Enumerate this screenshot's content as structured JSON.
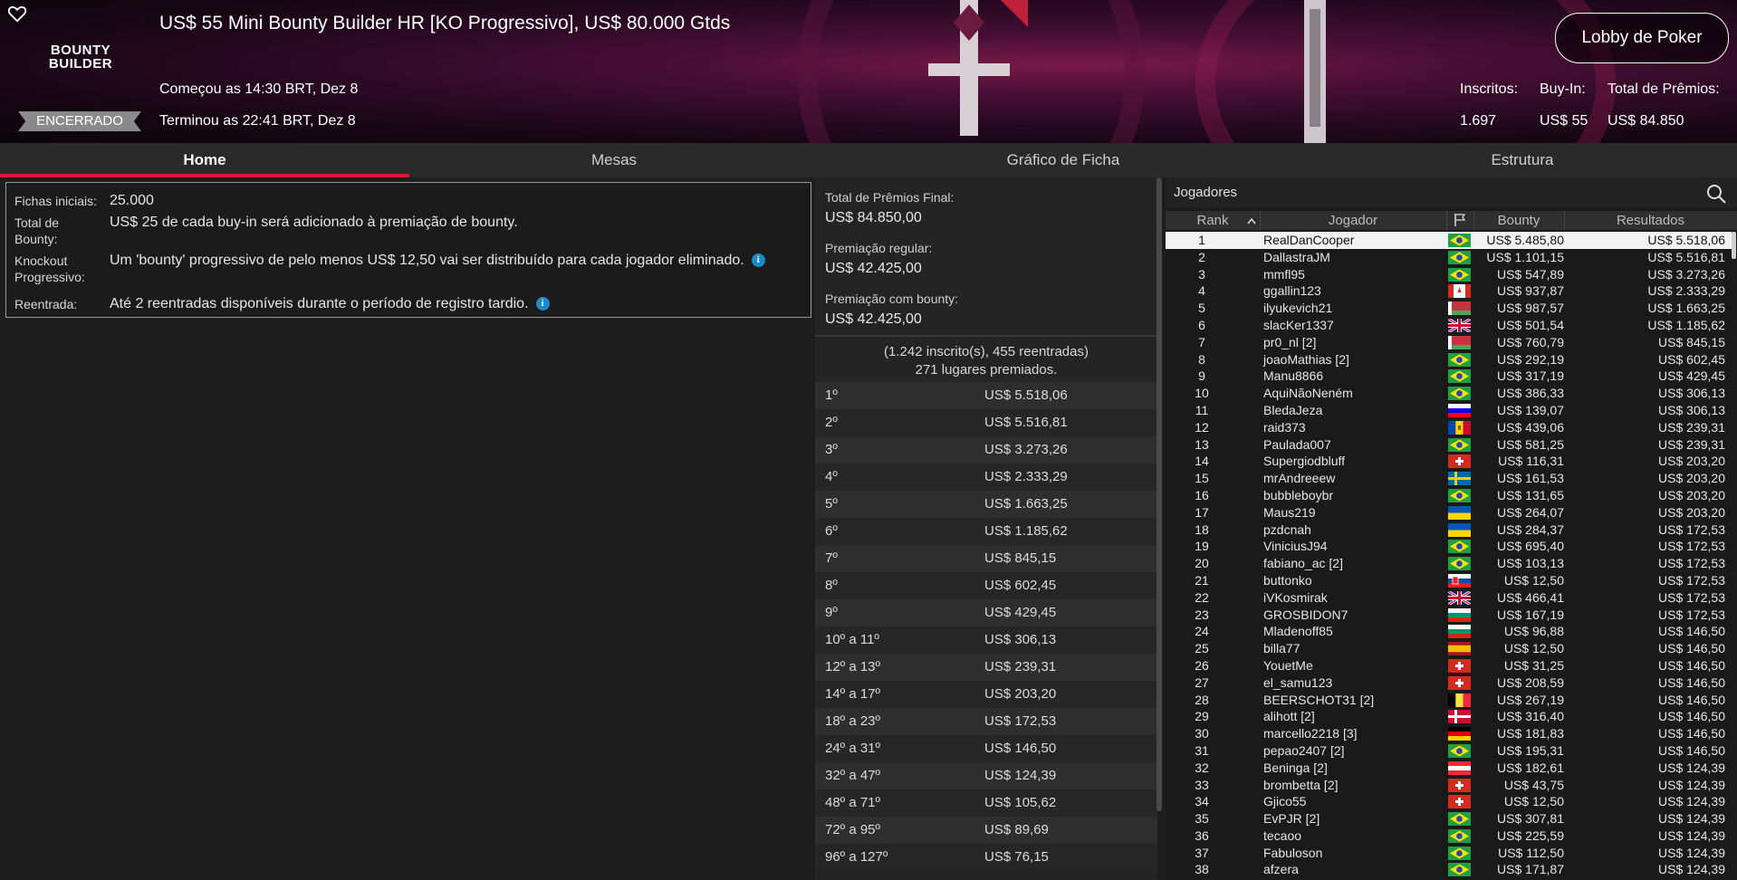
{
  "header": {
    "title": "US$ 55 Mini Bounty Builder HR [KO Progressivo], US$ 80.000 Gtds",
    "logo_line1": "BOUNTY",
    "logo_line2": "BUILDER",
    "status": "ENCERRADO",
    "started": "Começou as 14:30 BRT, Dez 8",
    "ended": "Terminou as 22:41 BRT, Dez 8",
    "lobby_button": "Lobby de Poker",
    "stats": {
      "entrants_label": "Inscritos:",
      "entrants_value": "1.697",
      "buyin_label": "Buy-In:",
      "buyin_value": "US$ 55",
      "prize_label": "Total de Prêmios:",
      "prize_value": "US$ 84.850"
    },
    "favorite_icon": "heart-outline-icon"
  },
  "tabs": [
    "Home",
    "Mesas",
    "Gráfico de Ficha",
    "Estrutura"
  ],
  "info": {
    "rows": [
      {
        "label": "Fichas iniciais:",
        "value": "25.000"
      },
      {
        "label": "Total de Bounty:",
        "value": "US$ 25 de cada buy-in será adicionado à premiação de bounty."
      },
      {
        "label": "Knockout Progressivo:",
        "value": "Um 'bounty' progressivo de pelo menos US$ 12,50 vai ser distribuído para cada jogador eliminado."
      },
      {
        "label": "Reentrada:",
        "value": "Até 2 reentradas disponíveis durante o período de registro tardio."
      }
    ],
    "info_icon": "i"
  },
  "prizes": {
    "total_label": "Total de Prêmios Final:",
    "total_value": "US$ 84.850,00",
    "regular_label": "Premiação regular:",
    "regular_value": "US$ 42.425,00",
    "bounty_label": "Premiação com bounty:",
    "bounty_value": "US$ 42.425,00",
    "summary_line1": "(1.242 inscrito(s), 455 reentradas)",
    "summary_line2": "271 lugares premiados.",
    "rows": [
      {
        "pos": "1º",
        "amount": "US$ 5.518,06"
      },
      {
        "pos": "2º",
        "amount": "US$ 5.516,81"
      },
      {
        "pos": "3º",
        "amount": "US$ 3.273,26"
      },
      {
        "pos": "4º",
        "amount": "US$ 2.333,29"
      },
      {
        "pos": "5º",
        "amount": "US$ 1.663,25"
      },
      {
        "pos": "6º",
        "amount": "US$ 1.185,62"
      },
      {
        "pos": "7º",
        "amount": "US$ 845,15"
      },
      {
        "pos": "8º",
        "amount": "US$ 602,45"
      },
      {
        "pos": "9º",
        "amount": "US$ 429,45"
      },
      {
        "pos": "10º a 11º",
        "amount": "US$ 306,13"
      },
      {
        "pos": "12º a 13º",
        "amount": "US$ 239,31"
      },
      {
        "pos": "14º a 17º",
        "amount": "US$ 203,20"
      },
      {
        "pos": "18º a 23º",
        "amount": "US$ 172,53"
      },
      {
        "pos": "24º a 31º",
        "amount": "US$ 146,50"
      },
      {
        "pos": "32º a 47º",
        "amount": "US$ 124,39"
      },
      {
        "pos": "48º a 71º",
        "amount": "US$ 105,62"
      },
      {
        "pos": "72º a 95º",
        "amount": "US$ 89,69"
      },
      {
        "pos": "96º a 127º",
        "amount": "US$ 76,15"
      }
    ]
  },
  "players": {
    "title": "Jogadores",
    "search_icon": "search-icon",
    "columns": {
      "rank": "Rank",
      "player": "Jogador",
      "country": "flag-icon",
      "bounty": "Bounty",
      "results": "Resultados"
    },
    "rows": [
      {
        "rank": "1",
        "name": "RealDanCooper",
        "flag": "BR",
        "bounty": "US$ 5.485,80",
        "result": "US$ 5.518,06"
      },
      {
        "rank": "2",
        "name": "DallastraJM",
        "flag": "BR",
        "bounty": "US$ 1.101,15",
        "result": "US$ 5.516,81"
      },
      {
        "rank": "3",
        "name": "mmfl95",
        "flag": "BR",
        "bounty": "US$ 547,89",
        "result": "US$ 3.273,26"
      },
      {
        "rank": "4",
        "name": "ggallin123",
        "flag": "CA",
        "bounty": "US$ 937,87",
        "result": "US$ 2.333,29"
      },
      {
        "rank": "5",
        "name": "ilyukevich21",
        "flag": "BY",
        "bounty": "US$ 987,57",
        "result": "US$ 1.663,25"
      },
      {
        "rank": "6",
        "name": "slacKer1337",
        "flag": "GB",
        "bounty": "US$ 501,54",
        "result": "US$ 1.185,62"
      },
      {
        "rank": "7",
        "name": "pr0_nl [2]",
        "flag": "BY",
        "bounty": "US$ 760,79",
        "result": "US$ 845,15"
      },
      {
        "rank": "8",
        "name": "joaoMathias [2]",
        "flag": "BR",
        "bounty": "US$ 292,19",
        "result": "US$ 602,45"
      },
      {
        "rank": "9",
        "name": "Manu8866",
        "flag": "BR",
        "bounty": "US$ 317,19",
        "result": "US$ 429,45"
      },
      {
        "rank": "10",
        "name": "AquiNãoNeném",
        "flag": "BR",
        "bounty": "US$ 386,33",
        "result": "US$ 306,13"
      },
      {
        "rank": "11",
        "name": "BledaJeza",
        "flag": "SI",
        "bounty": "US$ 139,07",
        "result": "US$ 306,13"
      },
      {
        "rank": "12",
        "name": "raid373",
        "flag": "MD",
        "bounty": "US$ 439,06",
        "result": "US$ 239,31"
      },
      {
        "rank": "13",
        "name": "Paulada007",
        "flag": "BR",
        "bounty": "US$ 581,25",
        "result": "US$ 239,31"
      },
      {
        "rank": "14",
        "name": "Supergiodbluff",
        "flag": "CH",
        "bounty": "US$ 116,31",
        "result": "US$ 203,20"
      },
      {
        "rank": "15",
        "name": "mrAndreeew",
        "flag": "SE",
        "bounty": "US$ 161,53",
        "result": "US$ 203,20"
      },
      {
        "rank": "16",
        "name": "bubbleboybr",
        "flag": "BR",
        "bounty": "US$ 131,65",
        "result": "US$ 203,20"
      },
      {
        "rank": "17",
        "name": "Maus219",
        "flag": "UA",
        "bounty": "US$ 264,07",
        "result": "US$ 203,20"
      },
      {
        "rank": "18",
        "name": "pzdcnah",
        "flag": "UA",
        "bounty": "US$ 284,37",
        "result": "US$ 172,53"
      },
      {
        "rank": "19",
        "name": "ViniciusJ94",
        "flag": "BR",
        "bounty": "US$ 695,40",
        "result": "US$ 172,53"
      },
      {
        "rank": "20",
        "name": "fabiano_ac [2]",
        "flag": "BR",
        "bounty": "US$ 103,13",
        "result": "US$ 172,53"
      },
      {
        "rank": "21",
        "name": "buttonko",
        "flag": "SK",
        "bounty": "US$ 12,50",
        "result": "US$ 172,53"
      },
      {
        "rank": "22",
        "name": "iVKosmirak",
        "flag": "GB",
        "bounty": "US$ 466,41",
        "result": "US$ 172,53"
      },
      {
        "rank": "23",
        "name": "GROSBIDON7",
        "flag": "BG",
        "bounty": "US$ 167,19",
        "result": "US$ 172,53"
      },
      {
        "rank": "24",
        "name": "Mladenoff85",
        "flag": "BG",
        "bounty": "US$ 96,88",
        "result": "US$ 146,50"
      },
      {
        "rank": "25",
        "name": "billa77",
        "flag": "ES",
        "bounty": "US$ 12,50",
        "result": "US$ 146,50"
      },
      {
        "rank": "26",
        "name": "YouetMe",
        "flag": "CH",
        "bounty": "US$ 31,25",
        "result": "US$ 146,50"
      },
      {
        "rank": "27",
        "name": "el_samu123",
        "flag": "CH",
        "bounty": "US$ 208,59",
        "result": "US$ 146,50"
      },
      {
        "rank": "28",
        "name": "BEERSCHOT31 [2]",
        "flag": "BE",
        "bounty": "US$ 267,19",
        "result": "US$ 146,50"
      },
      {
        "rank": "29",
        "name": "alihott [2]",
        "flag": "DK",
        "bounty": "US$ 316,40",
        "result": "US$ 146,50"
      },
      {
        "rank": "30",
        "name": "marcello2218 [3]",
        "flag": "DE",
        "bounty": "US$ 181,83",
        "result": "US$ 146,50"
      },
      {
        "rank": "31",
        "name": "pepao2407 [2]",
        "flag": "BR",
        "bounty": "US$ 195,31",
        "result": "US$ 146,50"
      },
      {
        "rank": "32",
        "name": "Beninga [2]",
        "flag": "AT",
        "bounty": "US$ 182,61",
        "result": "US$ 124,39"
      },
      {
        "rank": "33",
        "name": "brombetta [2]",
        "flag": "CH",
        "bounty": "US$ 43,75",
        "result": "US$ 124,39"
      },
      {
        "rank": "34",
        "name": "Gjico55",
        "flag": "CH",
        "bounty": "US$ 12,50",
        "result": "US$ 124,39"
      },
      {
        "rank": "35",
        "name": "EvPJR [2]",
        "flag": "BR",
        "bounty": "US$ 307,81",
        "result": "US$ 124,39"
      },
      {
        "rank": "36",
        "name": "tecaoo",
        "flag": "BR",
        "bounty": "US$ 225,59",
        "result": "US$ 124,39"
      },
      {
        "rank": "37",
        "name": "Fabuloson",
        "flag": "BR",
        "bounty": "US$ 112,50",
        "result": "US$ 124,39"
      },
      {
        "rank": "38",
        "name": "afzera",
        "flag": "BR",
        "bounty": "US$ 171,87",
        "result": "US$ 124,39"
      }
    ]
  },
  "colors": {
    "accent_red": "#d8192f",
    "header_magenta": "#7a1a48",
    "info_blue": "#1e88c8"
  }
}
